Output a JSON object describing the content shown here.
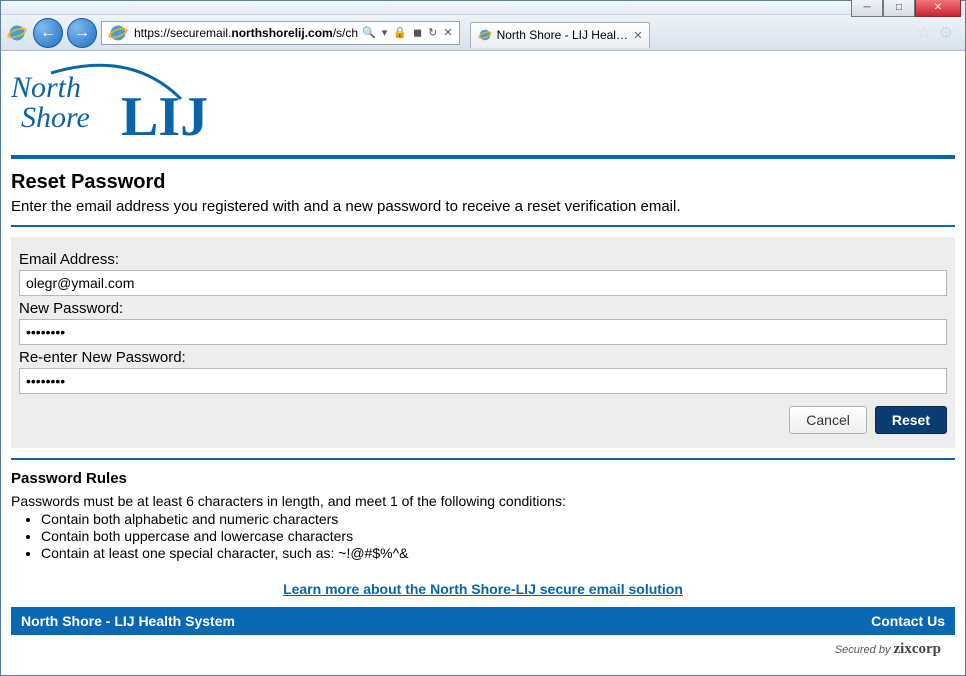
{
  "browser": {
    "url_prefix": "https://securemail.",
    "url_domain": "northshorelij.com",
    "url_suffix": "/s/ch",
    "tab_title": "North Shore - LIJ Health Sys..."
  },
  "logo": {
    "alt": "North Shore LIJ"
  },
  "heading": "Reset Password",
  "subheading": "Enter the email address you registered with and a new password to receive a reset verification email.",
  "form": {
    "email_label": "Email Address:",
    "email_value": "olegr@ymail.com",
    "new_pw_label": "New Password:",
    "new_pw_value": "••••••••",
    "re_pw_label": "Re-enter New Password:",
    "re_pw_value": "••••••••",
    "cancel_label": "Cancel",
    "reset_label": "Reset"
  },
  "rules": {
    "title": "Password Rules",
    "intro": "Passwords must be at least 6 characters in length, and meet 1 of the following conditions:",
    "items": [
      "Contain both alphabetic and numeric characters",
      "Contain both uppercase and lowercase characters",
      "Contain at least one special character, such as: ~!@#$%^&"
    ]
  },
  "learn_link": "Learn more about the North Shore-LIJ secure email solution",
  "footer": {
    "org": "North Shore - LIJ Health System",
    "contact": "Contact Us"
  },
  "secured_prefix": "Secured by ",
  "secured_brand": "zixcorp"
}
